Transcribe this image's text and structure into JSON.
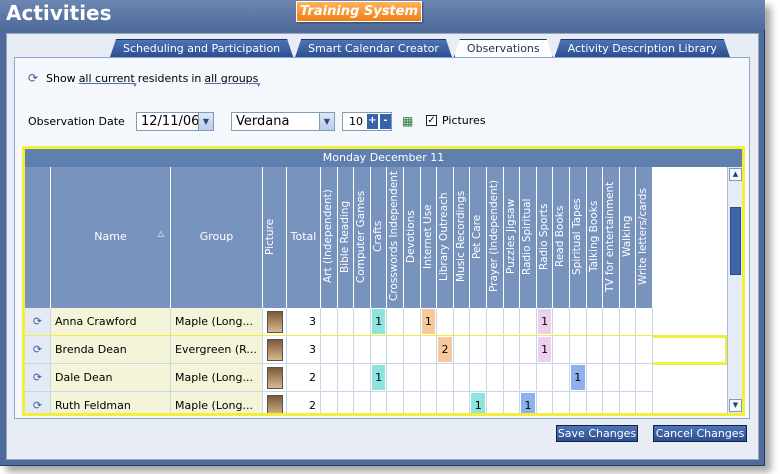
{
  "app": {
    "title": "Activities",
    "badge": "Training System"
  },
  "tabs": [
    {
      "label": "Scheduling and Participation",
      "active": false
    },
    {
      "label": "Smart Calendar Creator",
      "active": false
    },
    {
      "label": "Observations",
      "active": true
    },
    {
      "label": "Activity Description Library",
      "active": false
    }
  ],
  "filter": {
    "show": "Show",
    "who": "all current",
    "residents": "residents",
    "in": "in",
    "groups": "all groups"
  },
  "controls": {
    "date_label": "Observation Date",
    "date_value": "12/11/06",
    "font_value": "Verdana",
    "size_value": "10",
    "plus": "+",
    "minus": "-",
    "pictures_label": "Pictures",
    "pictures_checked": "✓"
  },
  "grid": {
    "date_header": "Monday December 11",
    "columns": {
      "name": "Name",
      "group": "Group",
      "picture": "Picture",
      "total": "Total",
      "activities": [
        "Art (Independent)",
        "Bible Reading",
        "Computer Games",
        "Crafts",
        "Crosswords Independent",
        "Devotions",
        "Internet Use",
        "Library Outreach",
        "Music Recordings",
        "Pet Care",
        "Prayer (Independent)",
        "Puzzles Jigsaw",
        "Radio Spiritual",
        "Radio Sports",
        "Read Books",
        "Spiritual Tapes",
        "Talking Books",
        "TV for entertainment",
        "Walking",
        "Write letters/cards"
      ]
    },
    "rows": [
      {
        "name": "Anna Crawford",
        "group": "Maple   (Long...",
        "total": "3",
        "marks": [
          {
            "col": 3,
            "value": "1",
            "color": "#8fe3dd"
          },
          {
            "col": 6,
            "value": "1",
            "color": "#f7c99a"
          },
          {
            "col": 13,
            "value": "1",
            "color": "#ecd1ef"
          }
        ]
      },
      {
        "name": "Brenda Dean",
        "group": "Evergreen  (R...",
        "total": "3",
        "marks": [
          {
            "col": 7,
            "value": "2",
            "color": "#f7c99a"
          },
          {
            "col": 13,
            "value": "1",
            "color": "#ecd1ef"
          }
        ]
      },
      {
        "name": "Dale Dean",
        "group": "Maple   (Long...",
        "total": "2",
        "marks": [
          {
            "col": 3,
            "value": "1",
            "color": "#8fe3dd"
          },
          {
            "col": 15,
            "value": "1",
            "color": "#8db1ec"
          }
        ]
      },
      {
        "name": "Ruth Feldman",
        "group": "Maple   (Long...",
        "total": "2",
        "marks": [
          {
            "col": 9,
            "value": "1",
            "color": "#8fe3dd"
          },
          {
            "col": 12,
            "value": "1",
            "color": "#8db1ec"
          }
        ]
      }
    ]
  },
  "buttons": {
    "save": "Save Changes",
    "cancel": "Cancel Changes"
  }
}
